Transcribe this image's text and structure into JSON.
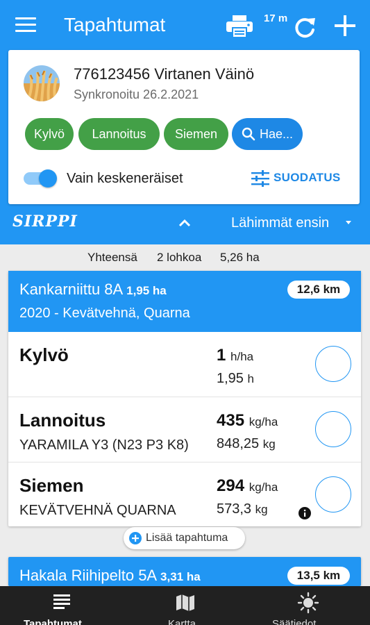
{
  "header": {
    "title": "Tapahtumat",
    "refresh_label": "17 m",
    "menu_icon": "hamburger-menu-icon",
    "print_icon": "print-icon",
    "refresh_icon": "refresh-icon",
    "add_icon": "add-icon",
    "color": "#2196f3"
  },
  "farm": {
    "name": "776123456 Virtanen Väinö",
    "sync": "Synkronoitu 26.2.2021",
    "avatar_icon": "wheat-avatar"
  },
  "chips": {
    "kylvo": "Kylvö",
    "lannoitus": "Lannoitus",
    "siemen": "Siemen",
    "search": "Hae..."
  },
  "filters": {
    "toggle_label": "Vain keskeneräiset",
    "toggle_on": true,
    "filter_label": "SUODATUS"
  },
  "subbar": {
    "brand": "SIRPPI",
    "sort": "Lähimmät ensin"
  },
  "summary": {
    "label": "Yhteensä",
    "count": "2 lohkoa",
    "area": "5,26 ha"
  },
  "fields": [
    {
      "name": "Kankarniittu 8A",
      "area": "1,95 ha",
      "crop": "2020 - Kevätvehnä, Quarna",
      "distance": "12,6 km",
      "events": [
        {
          "title": "Kylvö",
          "subtitle": "",
          "rate": "1",
          "rate_unit": "h/ha",
          "total": "1,95",
          "total_unit": "h",
          "info": false
        },
        {
          "title": "Lannoitus",
          "subtitle": "YARAMILA Y3 (N23 P3 K8)",
          "rate": "435",
          "rate_unit": "kg/ha",
          "total": "848,25",
          "total_unit": "kg",
          "info": false
        },
        {
          "title": "Siemen",
          "subtitle": "KEVÄTVEHNÄ QUARNA",
          "rate": "294",
          "rate_unit": "kg/ha",
          "total": "573,3",
          "total_unit": "kg",
          "info": true
        }
      ],
      "add_event": "Lisää tapahtuma"
    },
    {
      "name": "Hakala Riihipelto 5A",
      "area": "3,31 ha",
      "distance": "13,5 km"
    }
  ],
  "nav": [
    {
      "label": "Tapahtumat",
      "icon": "list-icon",
      "active": true
    },
    {
      "label": "Kartta",
      "icon": "map-icon",
      "active": false
    },
    {
      "label": "Säätiedot",
      "icon": "sun-icon",
      "active": false
    }
  ]
}
